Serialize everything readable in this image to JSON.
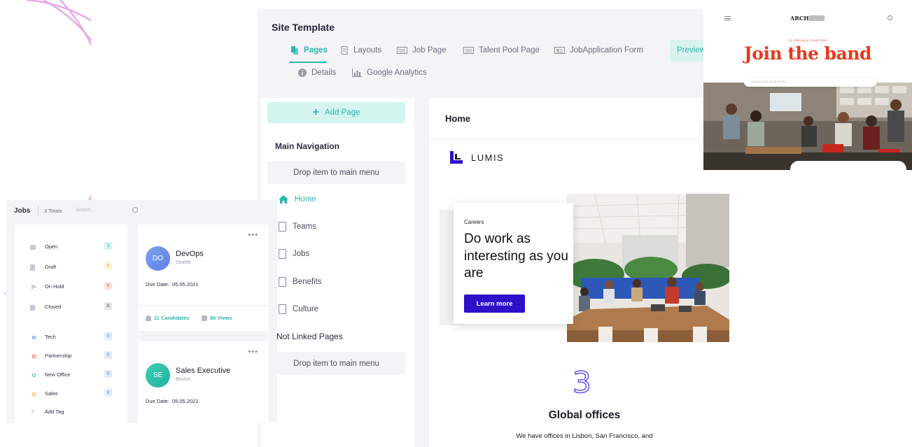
{
  "editor": {
    "title": "Site Template",
    "tabs": [
      {
        "label": "Pages",
        "icon": "pages-icon",
        "active": true
      },
      {
        "label": "Layouts",
        "icon": "layouts-icon"
      },
      {
        "label": "Job Page",
        "icon": "job-page-icon"
      },
      {
        "label": "Talent Pool Page",
        "icon": "talent-pool-icon"
      },
      {
        "label": "JobApplication Form",
        "icon": "form-icon"
      },
      {
        "label": "Details",
        "icon": "info-icon"
      },
      {
        "label": "Google Analytics",
        "icon": "analytics-icon"
      }
    ],
    "preview_label": "Preview",
    "accent": "#2bb7b0"
  },
  "pages": {
    "add_label": "Add Page",
    "main_nav_title": "Main Navigation",
    "drop_label": "Drop item to main menu",
    "items": [
      "Home",
      "Teams",
      "Jobs",
      "Benefits",
      "Culture"
    ],
    "not_linked_title": "Not Linked Pages",
    "drop_label_2": "Drop item to main menu"
  },
  "preview": {
    "page_title": "Home",
    "brand": "LUMIS",
    "careers_eyebrow": "Careers",
    "careers_heading": "Do work as interesting as you are",
    "cta_label": "Learn more",
    "cta_color": "#2d10c9",
    "stat_number": "3",
    "stat_title": "Global offices",
    "stat_desc": "We have offices in Lisbon, San Francisco, and"
  },
  "jobs": {
    "title": "Jobs",
    "total": "3 Totals",
    "search_placeholder": "Search...",
    "statuses": [
      {
        "label": "Open",
        "count": "3",
        "icon": "open-icon"
      },
      {
        "label": "Draft",
        "count": "0",
        "icon": "draft-icon"
      },
      {
        "label": "On Hold",
        "count": "0",
        "icon": "on-hold-icon"
      },
      {
        "label": "Closed",
        "count": "0",
        "icon": "closed-icon"
      }
    ],
    "tags": [
      {
        "label": "Tech",
        "count": "0",
        "color": "#3b7ddd"
      },
      {
        "label": "Partnership",
        "count": "0",
        "color": "#e0413b"
      },
      {
        "label": "New Office",
        "count": "0",
        "color": "#2bb7b0"
      },
      {
        "label": "Sales",
        "count": "0",
        "color": "#f29a1f"
      }
    ],
    "add_tag": "Add Tag",
    "cards": [
      {
        "initials": "DO",
        "name": "DevOps",
        "location": "Seattle",
        "due_label": "Due Date:",
        "due": "05.05.2021",
        "candidates": "11 Candidates",
        "views": "90 Views"
      },
      {
        "initials": "SE",
        "name": "Sales Executive",
        "location": "Boston",
        "due_label": "Due Date:",
        "due": "05.05.2021"
      }
    ]
  },
  "arch": {
    "logo": "ARCH",
    "kicker": "21 JOBS IN 6 LOCATIONS",
    "title": "Join the band",
    "search_placeholder": "SEARCH JOBS OR KEYWORD"
  }
}
